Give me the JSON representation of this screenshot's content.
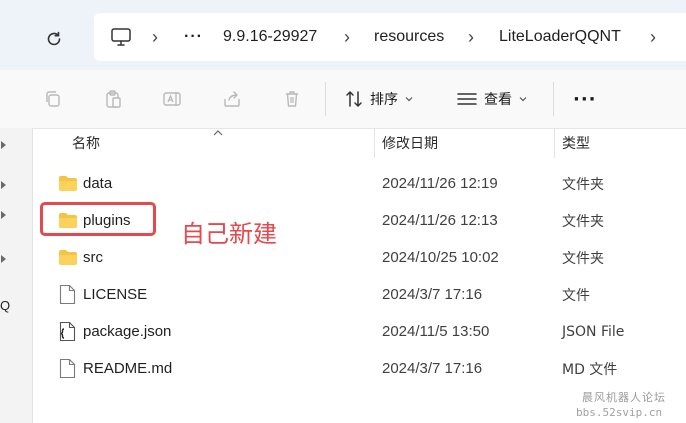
{
  "address_bar": {
    "ellipsis": "···",
    "crumbs": [
      "9.9.16-29927",
      "resources",
      "LiteLoaderQQNT"
    ],
    "separator": "›"
  },
  "toolbar": {
    "sort_label": "排序",
    "view_label": "查看",
    "more_label": "···"
  },
  "columns": {
    "name": "名称",
    "modified": "修改日期",
    "type": "类型"
  },
  "files": [
    {
      "name": "data",
      "modified": "2024/11/26 12:19",
      "type": "文件夹",
      "icon": "folder-icon"
    },
    {
      "name": "plugins",
      "modified": "2024/11/26 12:13",
      "type": "文件夹",
      "icon": "folder-icon"
    },
    {
      "name": "src",
      "modified": "2024/10/25 10:02",
      "type": "文件夹",
      "icon": "folder-icon"
    },
    {
      "name": "LICENSE",
      "modified": "2024/3/7 17:16",
      "type": "文件",
      "icon": "file-icon"
    },
    {
      "name": "package.json",
      "modified": "2024/11/5 13:50",
      "type": "JSON File",
      "icon": "json-file-icon"
    },
    {
      "name": "README.md",
      "modified": "2024/3/7 17:16",
      "type": "MD 文件",
      "icon": "file-icon"
    }
  ],
  "annotation": {
    "text": "自己新建",
    "color": "#e5484d"
  },
  "left_nav_partial_text": "Q",
  "watermark": {
    "line1": "晨风机器人论坛",
    "line2": "bbs.52svip.cn"
  },
  "colors": {
    "folder": "#f6c443",
    "highlight": "#e5484d",
    "topbar_bg": "#eef2f9"
  }
}
